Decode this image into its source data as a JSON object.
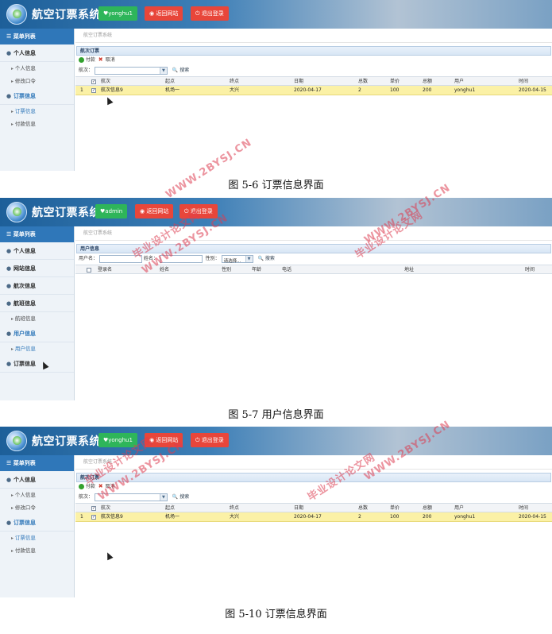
{
  "app": {
    "title": "航空订票系统",
    "buttons": {
      "home": "返回网站",
      "logout": "退出登录"
    },
    "sidebar_heading": "菜单列表"
  },
  "screen1": {
    "user_badge": "yonghu1",
    "breadcrumb": "航空订票系统",
    "sidebar": {
      "groups": [
        {
          "label": "个人信息",
          "items": [
            "个人信息",
            "修改口令"
          ]
        },
        {
          "label": "订票信息",
          "items": [
            "订票信息",
            "付款信息"
          ]
        }
      ]
    },
    "panel_title": "航次订票",
    "toolbar": {
      "pay": "付款",
      "cancel": "取消"
    },
    "filter": {
      "label": "航次：",
      "search": "搜索"
    },
    "columns": [
      "航次",
      "起点",
      "终点",
      "日期",
      "总数",
      "单价",
      "总额",
      "用户",
      "时间"
    ],
    "rows": [
      {
        "no": "1",
        "cells": [
          "航次信息9",
          "机场一",
          "大兴",
          "2020-04-17",
          "2",
          "100",
          "200",
          "yonghu1",
          "2020-04-15"
        ]
      }
    ],
    "caption": "图 5-6 订票信息界面"
  },
  "screen2": {
    "user_badge": "admin",
    "breadcrumb": "航空订票系统",
    "sidebar": {
      "groups": [
        {
          "label": "个人信息"
        },
        {
          "label": "网站信息"
        },
        {
          "label": "航次信息"
        },
        {
          "label": "航班信息",
          "items": [
            "航班信息"
          ]
        },
        {
          "label": "用户信息",
          "items": [
            "用户信息"
          ]
        },
        {
          "label": "订票信息"
        }
      ]
    },
    "panel_title": "用户信息",
    "filter": {
      "username": "用户名：",
      "name": "姓名：",
      "gender": "性别：",
      "gender_value": "请选择...",
      "search": "搜索"
    },
    "columns": [
      "登录名",
      "姓名",
      "性别",
      "年龄",
      "电话",
      "地址",
      "时间"
    ],
    "caption": "图 5-7 用户信息界面"
  },
  "screen3": {
    "caption": "图 5-10 订票信息界面"
  },
  "watermarks": [
    "WWW.2BYSJ.CN",
    "毕业设计论文网"
  ]
}
